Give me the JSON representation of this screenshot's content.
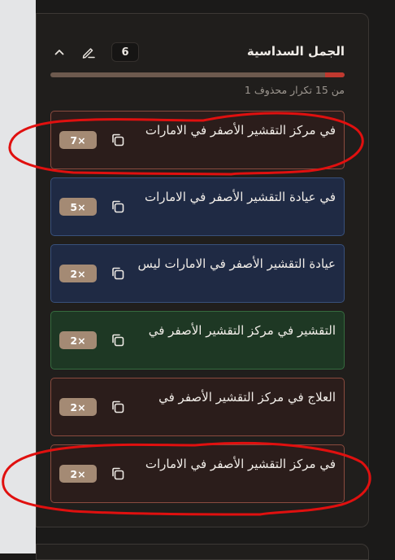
{
  "header": {
    "title": "الجمل السداسية",
    "count": "6",
    "pencil_icon": "pencil-icon",
    "collapse_icon": "chevron-up-icon"
  },
  "progress": {
    "deleted_fraction": 0.0667
  },
  "sub_note": "من 15 تكرار محذوف 1",
  "items": [
    {
      "text": "في مركز التقشير الأصفر في الامارات",
      "badge": "7×",
      "color": "red"
    },
    {
      "text": "في عيادة التقشير الأصفر في الامارات",
      "badge": "5×",
      "color": "blue"
    },
    {
      "text": "عيادة التقشير الأصفر في الامارات ليس",
      "badge": "2×",
      "color": "blue"
    },
    {
      "text": "التقشير في مركز التقشير الأصفر في",
      "badge": "2×",
      "color": "green"
    },
    {
      "text": "العلاج في مركز التقشير الأصفر في",
      "badge": "2×",
      "color": "red"
    },
    {
      "text": "في مركز التقشير الأصفر في الامارات",
      "badge": "2×",
      "color": "red"
    }
  ],
  "colors": {
    "annotation_stroke": "#e0100f",
    "progress_fill": "#6d5a4e",
    "progress_deleted": "#c0392f",
    "badge_bg": "#a48a74"
  }
}
